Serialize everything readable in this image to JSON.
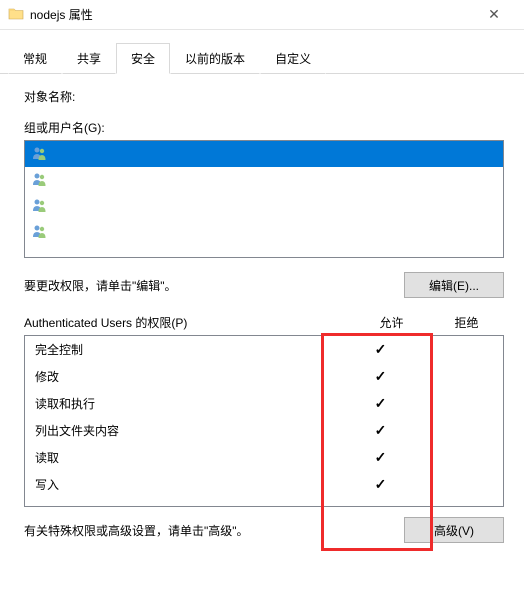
{
  "window": {
    "title": "nodejs 属性",
    "close": "✕"
  },
  "tabs": {
    "general": "常规",
    "share": "共享",
    "security": "安全",
    "previous": "以前的版本",
    "custom": "自定义",
    "active": "security"
  },
  "security": {
    "object_label": "对象名称:",
    "object_value": "",
    "groups_label": "组或用户名(G):",
    "users": [
      {
        "name": "",
        "selected": true
      },
      {
        "name": "",
        "selected": false
      },
      {
        "name": "",
        "selected": false
      },
      {
        "name": "",
        "selected": false
      }
    ],
    "edit_hint": "要更改权限，请单击\"编辑\"。",
    "edit_button": "编辑(E)...",
    "perm_title": "Authenticated Users 的权限(P)",
    "col_allow": "允许",
    "col_deny": "拒绝",
    "permissions": [
      {
        "name": "完全控制",
        "allow": true,
        "deny": false
      },
      {
        "name": "修改",
        "allow": true,
        "deny": false
      },
      {
        "name": "读取和执行",
        "allow": true,
        "deny": false
      },
      {
        "name": "列出文件夹内容",
        "allow": true,
        "deny": false
      },
      {
        "name": "读取",
        "allow": true,
        "deny": false
      },
      {
        "name": "写入",
        "allow": true,
        "deny": false
      }
    ],
    "adv_hint": "有关特殊权限或高级设置，请单击\"高级\"。",
    "adv_button": "高级(V)"
  }
}
